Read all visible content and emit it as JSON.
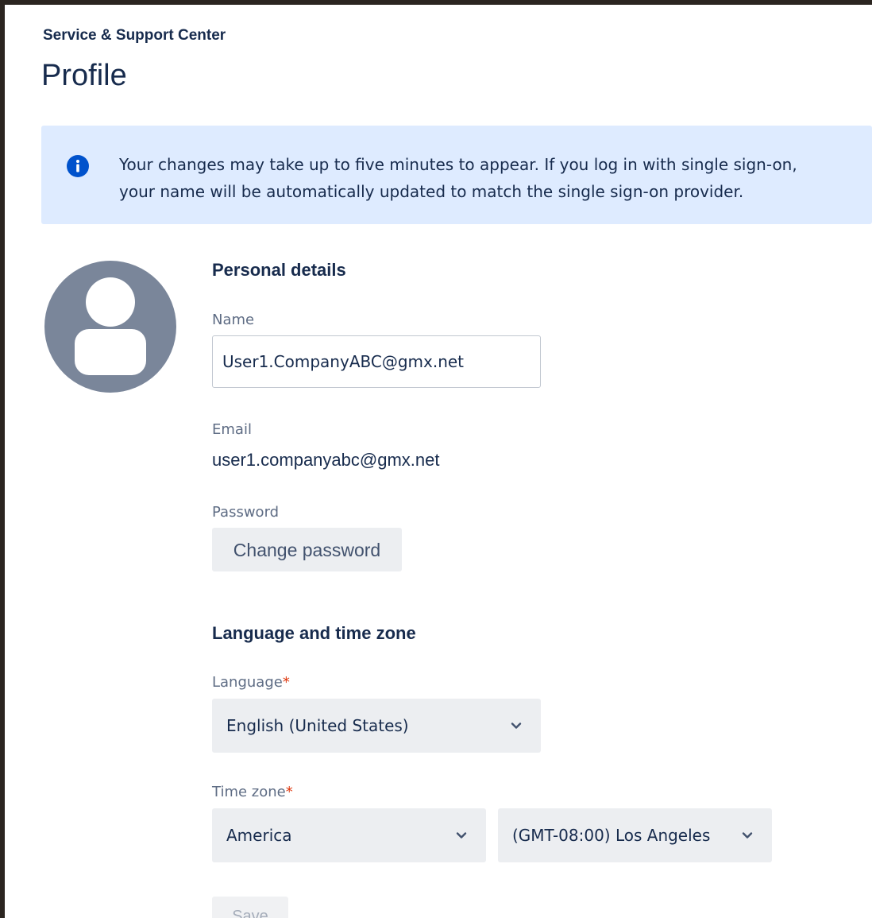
{
  "header": {
    "breadcrumb": "Service & Support Center",
    "title": "Profile"
  },
  "banner": {
    "icon": "info-icon",
    "line1": "Your changes may take up to five minutes to appear. If you log in with single sign-on,",
    "line2": "your name will be automatically updated to match the single sign-on provider."
  },
  "personal": {
    "heading": "Personal details",
    "name_label": "Name",
    "name_value": "User1.CompanyABC@gmx.net",
    "email_label": "Email",
    "email_value": "user1.companyabc@gmx.net",
    "password_label": "Password",
    "change_password_label": "Change password"
  },
  "locale": {
    "heading": "Language and time zone",
    "language_label": "Language",
    "language_value": "English (United States)",
    "timezone_label": "Time zone",
    "region_value": "America",
    "city_value": "(GMT-08:00) Los Angeles",
    "required_mark": "*"
  },
  "actions": {
    "save_label": "Save"
  },
  "colors": {
    "banner_bg": "#deebff",
    "info_icon": "#0052cc",
    "avatar": "#7a869a",
    "required": "#de350b"
  }
}
